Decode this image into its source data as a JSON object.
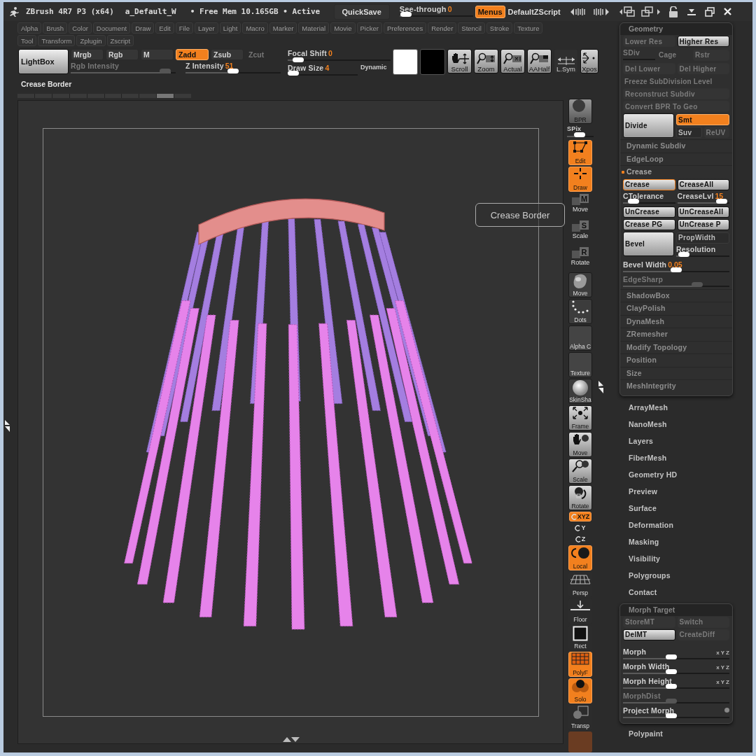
{
  "title_bar": {
    "app": "ZBrush 4R7 P3 (x64)",
    "document": "a_Default_W",
    "memory": "• Free Mem 10.165GB • Active",
    "quicksave": "QuickSave",
    "see_through": {
      "label": "See-through",
      "value": "0",
      "level": 0.02
    },
    "menus": {
      "label": "Menus",
      "on": true
    },
    "script": "DefaultZScript"
  },
  "menu_rows": [
    [
      "Alpha",
      "Brush",
      "Color",
      "Document",
      "Draw",
      "Edit",
      "File",
      "Layer",
      "Light",
      "Macro",
      "Marker",
      "Material",
      "Movie",
      "Picker",
      "Preferences",
      "Render",
      "Stencil",
      "Stroke",
      "Texture"
    ],
    [
      "Tool",
      "Transform",
      "Zplugin",
      "Zscript"
    ]
  ],
  "toolbar": {
    "lightbox": "LightBox",
    "modes": [
      {
        "label": "Mrgb",
        "on": false,
        "disabled": false
      },
      {
        "label": "Rgb",
        "on": false,
        "disabled": false
      },
      {
        "label": "M",
        "on": false,
        "disabled": false
      },
      {
        "label": "Zadd",
        "on": true,
        "disabled": false
      },
      {
        "label": "Zsub",
        "on": false,
        "disabled": false
      },
      {
        "label": "Zcut",
        "on": false,
        "disabled": true
      }
    ],
    "rgb_intensity": {
      "label": "Rgb Intensity",
      "level": 0.95,
      "disabled": true
    },
    "z_intensity": {
      "label": "Z Intensity",
      "value": "51",
      "level": 0.5
    },
    "focal_shift": {
      "label": "Focal Shift",
      "value": "0",
      "level": 0.05
    },
    "draw_size": {
      "label": "Draw Size",
      "value": "4",
      "level": 0.0
    },
    "dynamic": "Dynamic",
    "tools": [
      {
        "kind": "hand",
        "label": "Scroll"
      },
      {
        "kind": "zoom",
        "label": "Zoom"
      },
      {
        "kind": "actual",
        "label": "Actual"
      },
      {
        "kind": "half",
        "label": "AAHalf"
      },
      {
        "kind": "sym",
        "label": "L.Sym"
      },
      {
        "kind": "xpos",
        "label": "Xpos"
      }
    ]
  },
  "status": "Crease Border",
  "tooltip": "Crease Border",
  "shelf": [
    {
      "kind": "render",
      "label": "BPR",
      "on": false
    },
    {
      "kind": "slider",
      "label": "SPix",
      "level": 0.45
    },
    {
      "kind": "edit",
      "label": "Edit",
      "on": true
    },
    {
      "kind": "draw",
      "label": "Draw",
      "on": true
    },
    {
      "kind": "key",
      "key": "M",
      "label": "Move"
    },
    {
      "kind": "key",
      "key": "S",
      "label": "Scale"
    },
    {
      "kind": "key",
      "key": "R",
      "label": "Rotate"
    },
    {
      "kind": "brush",
      "label": "Move"
    },
    {
      "kind": "dots",
      "label": "Dots"
    },
    {
      "kind": "blank",
      "label": "Alpha C"
    },
    {
      "kind": "blank",
      "label": "Texture"
    },
    {
      "kind": "material",
      "label": "SkinSha"
    },
    {
      "kind": "frame",
      "label": "Frame",
      "on": false
    },
    {
      "kind": "move",
      "label": "Move",
      "on": false
    },
    {
      "kind": "scale",
      "label": "Scale",
      "on": false
    },
    {
      "kind": "rotate",
      "label": "Rotate",
      "on": false
    },
    {
      "kind": "axis",
      "label": "XYZ",
      "on": true
    },
    {
      "kind": "axis",
      "label": "Y",
      "on": false
    },
    {
      "kind": "axis",
      "label": "Z",
      "on": false
    },
    {
      "kind": "local",
      "label": "Local",
      "on": true
    },
    {
      "kind": "persp",
      "label": "Persp",
      "on": false
    },
    {
      "kind": "floor",
      "label": "Floor",
      "on": false
    },
    {
      "kind": "rect",
      "label": "Rect",
      "on": false
    },
    {
      "kind": "polyf",
      "label": "PolyF",
      "on": true
    },
    {
      "kind": "solo",
      "label": "Solo",
      "on": true
    },
    {
      "kind": "transp",
      "label": "Transp",
      "on": false
    },
    {
      "kind": "tile"
    }
  ],
  "geometry": {
    "title": "Geometry",
    "rows": [
      {
        "kind": "row",
        "items": [
          {
            "kind": "button",
            "label": "Lower Res",
            "disabled": true
          },
          {
            "kind": "button",
            "label": "Higher Res",
            "disabled": false
          }
        ]
      },
      {
        "kind": "row",
        "items": [
          {
            "kind": "slider",
            "label": "SDiv",
            "disabled": true
          },
          {
            "kind": "label",
            "label": "Cage",
            "disabled": true
          },
          {
            "kind": "button",
            "label": "Rstr",
            "disabled": true
          }
        ]
      },
      {
        "kind": "row",
        "items": [
          {
            "kind": "button",
            "label": "Del Lower",
            "disabled": true
          },
          {
            "kind": "button",
            "label": "Del Higher",
            "disabled": true
          }
        ]
      },
      {
        "kind": "row",
        "items": [
          {
            "kind": "label",
            "label": "Freeze SubDivision Level",
            "disabled": true
          }
        ]
      },
      {
        "kind": "row",
        "items": [
          {
            "kind": "button",
            "label": "Reconstruct Subdiv",
            "disabled": true
          }
        ]
      },
      {
        "kind": "row",
        "items": [
          {
            "kind": "button",
            "label": "Convert BPR To Geo",
            "disabled": true
          }
        ]
      },
      {
        "kind": "split",
        "main": {
          "label": "Divide"
        },
        "right": [
          [
            {
              "kind": "toggle",
              "label": "Smt",
              "on": true,
              "disabled": false
            }
          ],
          [
            {
              "kind": "toggle",
              "label": "Suv",
              "on": false,
              "disabled": false
            },
            {
              "kind": "button",
              "label": "ReUV",
              "disabled": true
            }
          ]
        ]
      },
      {
        "kind": "section",
        "label": "Dynamic Subdiv",
        "expanded": false
      },
      {
        "kind": "section",
        "label": "EdgeLoop",
        "expanded": false
      },
      {
        "kind": "section",
        "label": "Crease",
        "expanded": true
      },
      {
        "kind": "row",
        "items": [
          {
            "kind": "button",
            "label": "Crease",
            "disabled": false,
            "focused": true
          },
          {
            "kind": "button",
            "label": "CreaseAll",
            "disabled": false,
            "focused": false
          }
        ]
      },
      {
        "kind": "row",
        "items": [
          {
            "kind": "slider",
            "label": "CTolerance",
            "level": 0.12
          },
          {
            "kind": "slider",
            "label": "CreaseLvl",
            "value": "15",
            "level": 0.95
          }
        ]
      },
      {
        "kind": "row",
        "items": [
          {
            "kind": "button",
            "label": "UnCrease",
            "disabled": false
          },
          {
            "kind": "button",
            "label": "UnCreaseAll",
            "disabled": false
          }
        ]
      },
      {
        "kind": "row",
        "items": [
          {
            "kind": "button",
            "label": "Crease PG",
            "disabled": false
          },
          {
            "kind": "button",
            "label": "UnCrease P",
            "disabled": false
          }
        ]
      },
      {
        "kind": "split",
        "main": {
          "label": "Bevel"
        },
        "right": [
          [
            {
              "kind": "toggle",
              "label": "PropWidth",
              "on": false,
              "disabled": false
            }
          ],
          [
            {
              "kind": "slider",
              "label": "Resolution",
              "level": 0.05
            }
          ]
        ]
      },
      {
        "kind": "row",
        "items": [
          {
            "kind": "slider",
            "label": "Bevel Width",
            "value": "0.05",
            "level": 0.5
          }
        ]
      },
      {
        "kind": "row",
        "items": [
          {
            "kind": "slider",
            "label": "EdgeSharp",
            "level": 0.72,
            "disabled": true
          }
        ]
      },
      {
        "kind": "section",
        "label": "ShadowBox",
        "expanded": false
      },
      {
        "kind": "section",
        "label": "ClayPolish",
        "expanded": false
      },
      {
        "kind": "section",
        "label": "DynaMesh",
        "expanded": false
      },
      {
        "kind": "section",
        "label": "ZRemesher",
        "expanded": false
      },
      {
        "kind": "section",
        "label": "Modify Topology",
        "expanded": false
      },
      {
        "kind": "section",
        "label": "Position",
        "expanded": false
      },
      {
        "kind": "section",
        "label": "Size",
        "expanded": false
      },
      {
        "kind": "section",
        "label": "MeshIntegrity",
        "expanded": false
      }
    ]
  },
  "tool_sections": [
    "ArrayMesh",
    "NanoMesh",
    "Layers",
    "FiberMesh",
    "Geometry HD",
    "Preview",
    "Surface",
    "Deformation",
    "Masking",
    "Visibility",
    "Polygroups",
    "Contact"
  ],
  "morph_target": {
    "title": "Morph Target",
    "rows": [
      {
        "kind": "row",
        "items": [
          {
            "kind": "button",
            "label": "StoreMT",
            "disabled": true
          },
          {
            "kind": "button",
            "label": "Switch",
            "disabled": true
          }
        ]
      },
      {
        "kind": "row",
        "items": [
          {
            "kind": "button",
            "label": "DelMT",
            "disabled": false
          },
          {
            "kind": "button",
            "label": "CreateDiff",
            "disabled": true
          }
        ]
      },
      {
        "kind": "gap"
      },
      {
        "kind": "row",
        "items": [
          {
            "kind": "slider",
            "label": "Morph",
            "level": 0.45,
            "axes": "x Y Z"
          }
        ]
      },
      {
        "kind": "row",
        "items": [
          {
            "kind": "slider",
            "label": "Morph Width",
            "level": 0.45,
            "axes": "x Y Z"
          }
        ]
      },
      {
        "kind": "row",
        "items": [
          {
            "kind": "slider",
            "label": "Morph Height",
            "level": 0.45,
            "axes": "x Y Z"
          }
        ]
      },
      {
        "kind": "row",
        "items": [
          {
            "kind": "slider",
            "label": "MorphDist",
            "level": 0.45,
            "disabled": true
          }
        ]
      },
      {
        "kind": "row",
        "items": [
          {
            "kind": "slider",
            "label": "Project Morph",
            "level": 0.45,
            "switch_on": false
          }
        ]
      }
    ]
  },
  "last_section": "Polypaint"
}
